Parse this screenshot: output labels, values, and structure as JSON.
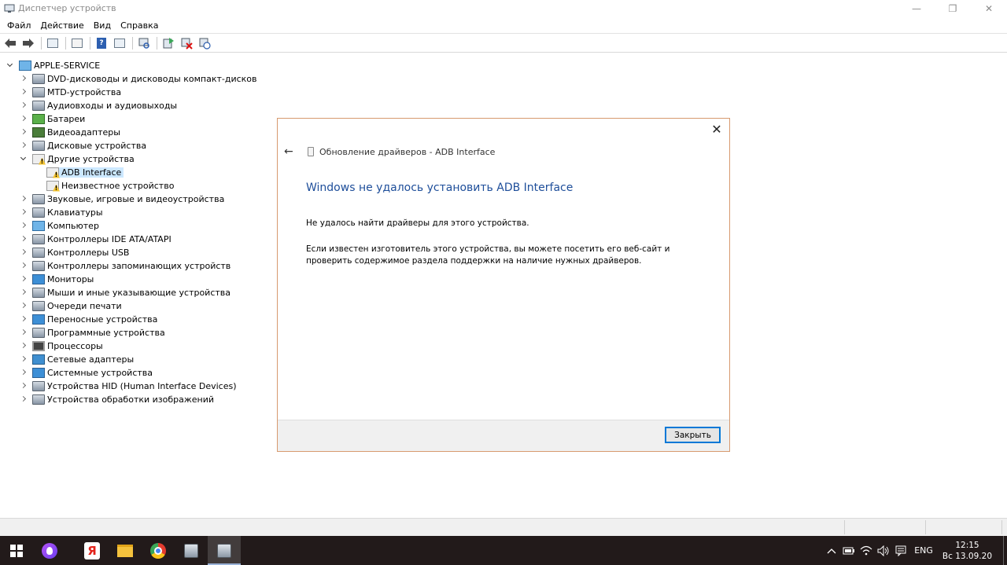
{
  "window": {
    "title": "Диспетчер устройств",
    "buttons": {
      "minimize": "—",
      "restore": "❐",
      "close": "✕"
    }
  },
  "menu": [
    "Файл",
    "Действие",
    "Вид",
    "Справка"
  ],
  "toolbar": {
    "icons": [
      "back-arrow-icon",
      "forward-arrow-icon",
      "properties-icon",
      "show-hide-icon",
      "help-icon",
      "view-icon",
      "scan-hardware-icon",
      "update-driver-icon",
      "uninstall-device-icon",
      "disable-device-icon"
    ]
  },
  "tree": {
    "root": "APPLE-SERVICE",
    "categories": [
      {
        "label": "DVD-дисководы и дисководы компакт-дисков",
        "icon": "dvd-drive-icon"
      },
      {
        "label": "MTD-устройства",
        "icon": "mtd-device-icon"
      },
      {
        "label": "Аудиовходы и аудиовыходы",
        "icon": "audio-icon"
      },
      {
        "label": "Батареи",
        "icon": "battery-icon"
      },
      {
        "label": "Видеоадаптеры",
        "icon": "display-adapter-icon"
      },
      {
        "label": "Дисковые устройства",
        "icon": "disk-drive-icon"
      },
      {
        "label": "Другие устройства",
        "icon": "other-devices-icon",
        "expanded": true,
        "children": [
          {
            "label": "ADB Interface",
            "icon": "warning-device-icon",
            "selected": true
          },
          {
            "label": "Неизвестное устройство",
            "icon": "warning-device-icon"
          }
        ]
      },
      {
        "label": "Звуковые, игровые и видеоустройства",
        "icon": "sound-icon"
      },
      {
        "label": "Клавиатуры",
        "icon": "keyboard-icon"
      },
      {
        "label": "Компьютер",
        "icon": "computer-icon"
      },
      {
        "label": "Контроллеры IDE ATA/ATAPI",
        "icon": "ide-controller-icon"
      },
      {
        "label": "Контроллеры USB",
        "icon": "usb-icon"
      },
      {
        "label": "Контроллеры запоминающих устройств",
        "icon": "storage-controller-icon"
      },
      {
        "label": "Мониторы",
        "icon": "monitor-icon"
      },
      {
        "label": "Мыши и иные указывающие устройства",
        "icon": "mouse-icon"
      },
      {
        "label": "Очереди печати",
        "icon": "printer-icon"
      },
      {
        "label": "Переносные устройства",
        "icon": "portable-device-icon"
      },
      {
        "label": "Программные устройства",
        "icon": "software-device-icon"
      },
      {
        "label": "Процессоры",
        "icon": "processor-icon"
      },
      {
        "label": "Сетевые адаптеры",
        "icon": "network-adapter-icon"
      },
      {
        "label": "Системные устройства",
        "icon": "system-device-icon"
      },
      {
        "label": "Устройства HID (Human Interface Devices)",
        "icon": "hid-icon"
      },
      {
        "label": "Устройства обработки изображений",
        "icon": "imaging-device-icon"
      }
    ]
  },
  "dialog": {
    "header": "Обновление драйверов - ADB Interface",
    "title": "Windows не удалось установить ADB Interface",
    "message1": "Не удалось найти драйверы для этого устройства.",
    "message2": "Если известен изготовитель этого устройства, вы можете посетить его веб-сайт и проверить содержимое раздела поддержки на наличие нужных драйверов.",
    "close_button": "Закрыть"
  },
  "taskbar": {
    "apps": [
      "start-icon",
      "alice-icon",
      "yandex-browser-icon",
      "file-explorer-icon",
      "chrome-icon",
      "device-manager-icon",
      "device-manager-active-icon"
    ],
    "yandex_letter": "Я",
    "language": "ENG",
    "time": "12:15",
    "date": "Вс 13.09.20"
  }
}
